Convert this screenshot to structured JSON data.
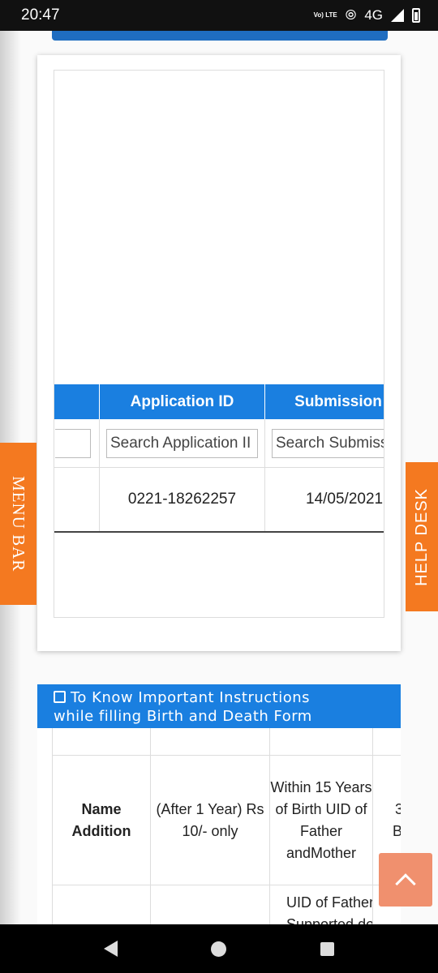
{
  "status_bar": {
    "time": "20:47",
    "volte": "Vo) LTE",
    "network": "4G"
  },
  "side_tabs": {
    "menu": "MENU BAR",
    "help": "HELP DESK"
  },
  "table": {
    "headers": [
      "",
      "Application ID",
      "Submission D"
    ],
    "filters": [
      "",
      "Search Application II",
      "Search Submiss"
    ],
    "rows": [
      {
        "col0": "",
        "application_id": "0221-18262257",
        "submission_date": "14/05/2021"
      }
    ]
  },
  "instructions": {
    "title_line1": "To Know Important Instructions",
    "title_line2": "while filling Birth and Death Form",
    "row1": {
      "col0": "Name Addition",
      "col1": "(After 1 Year) Rs 10/- only",
      "col2": "Within 15 Years of Birth UID of Father andMother",
      "col3_line1": "3",
      "col3_line2": "Bi"
    },
    "row2": {
      "col2_line1": "UID of Father an",
      "col2_line2": "Supported doc"
    }
  },
  "icons": [
    "wifi-calling-icon",
    "signal-icon",
    "battery-icon",
    "note-icon",
    "chevron-up-icon",
    "back-icon",
    "home-icon",
    "recents-icon"
  ],
  "colors": {
    "primary_blue": "#1a7fe0",
    "accent_orange": "#f47920",
    "scroll_top": "#f0906e"
  }
}
